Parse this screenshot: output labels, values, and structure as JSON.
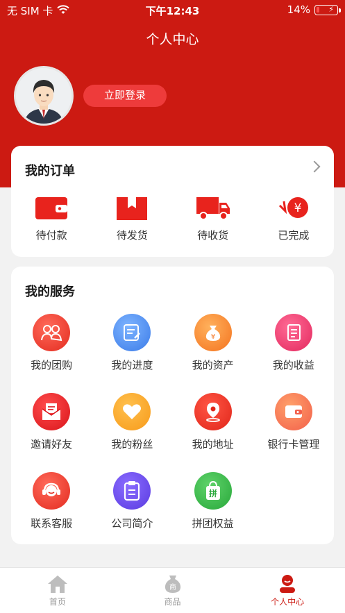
{
  "status_bar": {
    "carrier": "无 SIM 卡",
    "time": "下午12:43",
    "battery_percent": "14%",
    "battery_level": 0.14
  },
  "header": {
    "title": "个人中心",
    "login_label": "立即登录"
  },
  "orders": {
    "title": "我的订单",
    "items": [
      {
        "label": "待付款",
        "icon": "wallet-icon"
      },
      {
        "label": "待发货",
        "icon": "gift-box-icon"
      },
      {
        "label": "待收货",
        "icon": "truck-icon"
      },
      {
        "label": "已完成",
        "icon": "yen-coin-icon"
      }
    ]
  },
  "services": {
    "title": "我的服务",
    "items": [
      {
        "label": "我的团购",
        "icon": "group-users-icon"
      },
      {
        "label": "我的进度",
        "icon": "progress-note-icon"
      },
      {
        "label": "我的资产",
        "icon": "money-bag-icon"
      },
      {
        "label": "我的收益",
        "icon": "earnings-doc-icon"
      },
      {
        "label": "邀请好友",
        "icon": "invite-mail-icon"
      },
      {
        "label": "我的粉丝",
        "icon": "heart-icon"
      },
      {
        "label": "我的地址",
        "icon": "location-pin-icon"
      },
      {
        "label": "银行卡管理",
        "icon": "bank-card-icon"
      },
      {
        "label": "联系客服",
        "icon": "headset-icon"
      },
      {
        "label": "公司简介",
        "icon": "clipboard-icon"
      },
      {
        "label": "拼团权益",
        "icon": "pin-bag-icon"
      }
    ]
  },
  "tabbar": {
    "items": [
      {
        "label": "首页",
        "icon": "home-icon",
        "active": false
      },
      {
        "label": "商品",
        "icon": "product-bag-icon",
        "active": false
      },
      {
        "label": "个人中心",
        "icon": "profile-icon",
        "active": true
      }
    ]
  },
  "colors": {
    "brand_red": "#cc1a12",
    "login_button": "#ee3b3b",
    "tab_active": "#cc1a12",
    "tab_inactive": "#999999"
  }
}
